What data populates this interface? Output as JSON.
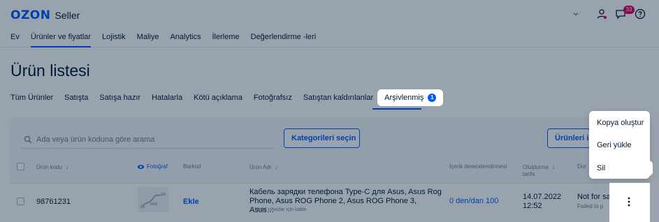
{
  "brand": {
    "logo_text": "OZON",
    "product": "Seller"
  },
  "header": {
    "chat_badge": "33"
  },
  "main_nav": [
    {
      "label": "Ev",
      "active": false
    },
    {
      "label": "Ürünler ve fiyatlar",
      "active": true
    },
    {
      "label": "Lojistik",
      "active": false
    },
    {
      "label": "Maliye",
      "active": false
    },
    {
      "label": "Analytics",
      "active": false
    },
    {
      "label": "İlerleme",
      "active": false
    },
    {
      "label": "Değerlendirme -leri",
      "active": false
    }
  ],
  "page_title": "Ürün listesi",
  "sub_tabs": [
    {
      "label": "Tüm Ürünler"
    },
    {
      "label": "Satışta"
    },
    {
      "label": "Satışa hazır"
    },
    {
      "label": "Hatalarla"
    },
    {
      "label": "Kötü açıklama"
    },
    {
      "label": "Fotoğrafsız"
    },
    {
      "label": "Satıştan kaldırılanlar"
    }
  ],
  "active_tab": {
    "label": "Arşivlenmiş",
    "count": "1"
  },
  "search": {
    "placeholder": "Ada veya ürün koduna göre arama",
    "value": ""
  },
  "buttons": {
    "categories": "Kategorileri seçin",
    "products": "Ürünleri i"
  },
  "table": {
    "headers": {
      "product_code": "Ürün kodu",
      "photo": "Fotoğraf",
      "barcode": "Barkod",
      "name": "Ürün Adı",
      "rating": "İçerik derecelendirmesi",
      "created_l1": "Oluşturma",
      "created_l2": "tarihi",
      "status": "Dur"
    },
    "row": {
      "product_code": "98761231",
      "barcode_action": "Ekle",
      "name": "Кабель зарядки телефона Type-C для Asus, Asus Rog Phone, Asus ROG Phone 2, Asus ROG Phone 3, Asus…",
      "category": "../ Mobil cihazlar için kablo",
      "rating": "0 den/dan 100",
      "created_date": "14.07.2022",
      "created_time": "12:52",
      "status": "Not for sa",
      "status_sub": "Failed to p"
    }
  },
  "context_menu": {
    "items": [
      "Kopya oluştur",
      "Geri yükle",
      "Sil"
    ]
  },
  "colors": {
    "accent": "#005bff",
    "text": "#001a34",
    "muted": "#707f8d",
    "badge": "#e0005c"
  }
}
